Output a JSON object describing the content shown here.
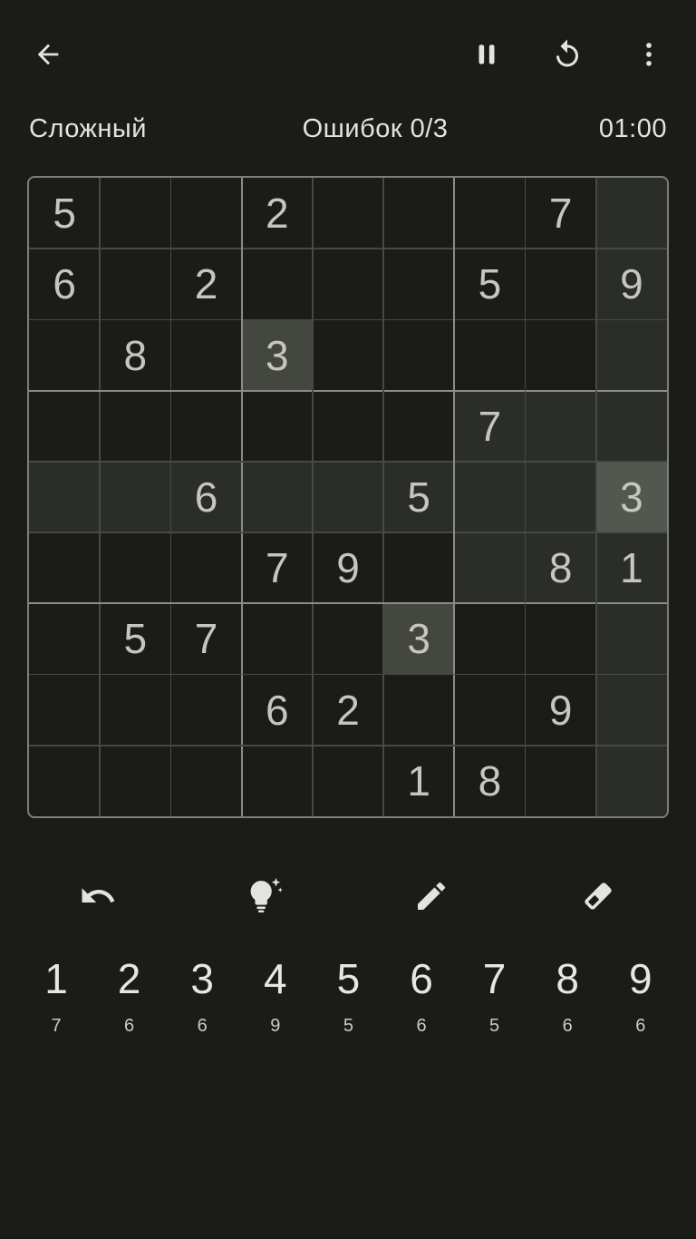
{
  "header": {
    "back_icon": "arrow-left-icon",
    "pause_icon": "pause-icon",
    "restart_icon": "restart-icon",
    "menu_icon": "more-vertical-icon"
  },
  "status": {
    "difficulty": "Сложный",
    "mistakes": "Ошибок 0/3",
    "timer": "01:00"
  },
  "board": {
    "rows": [
      [
        "5",
        "",
        "",
        "2",
        "",
        "",
        "",
        "7",
        ""
      ],
      [
        "6",
        "",
        "2",
        "",
        "",
        "",
        "5",
        "",
        "9"
      ],
      [
        "",
        "8",
        "",
        "3",
        "",
        "",
        "",
        "",
        ""
      ],
      [
        "",
        "",
        "",
        "",
        "",
        "",
        "7",
        "",
        ""
      ],
      [
        "",
        "",
        "6",
        "",
        "",
        "5",
        "",
        "",
        "3"
      ],
      [
        "",
        "",
        "",
        "7",
        "9",
        "",
        "",
        "8",
        "1"
      ],
      [
        "",
        "5",
        "7",
        "",
        "",
        "3",
        "",
        "",
        ""
      ],
      [
        "",
        "",
        "",
        "6",
        "2",
        "",
        "",
        "9",
        ""
      ],
      [
        "",
        "",
        "",
        "",
        "",
        "1",
        "8",
        "",
        ""
      ]
    ],
    "selected_cell": {
      "row": 4,
      "col": 8
    },
    "highlight_color": "#2b2d29",
    "same_number_color": "#434740",
    "selected_color": "#525750"
  },
  "tools": [
    {
      "name": "undo",
      "icon": "undo-icon"
    },
    {
      "name": "hint",
      "icon": "lightbulb-sparkle-icon"
    },
    {
      "name": "notes",
      "icon": "pencil-icon"
    },
    {
      "name": "erase",
      "icon": "eraser-icon"
    }
  ],
  "numpad": [
    {
      "digit": "1",
      "remaining": "7"
    },
    {
      "digit": "2",
      "remaining": "6"
    },
    {
      "digit": "3",
      "remaining": "6"
    },
    {
      "digit": "4",
      "remaining": "9"
    },
    {
      "digit": "5",
      "remaining": "5"
    },
    {
      "digit": "6",
      "remaining": "6"
    },
    {
      "digit": "7",
      "remaining": "5"
    },
    {
      "digit": "8",
      "remaining": "6"
    },
    {
      "digit": "9",
      "remaining": "6"
    }
  ]
}
